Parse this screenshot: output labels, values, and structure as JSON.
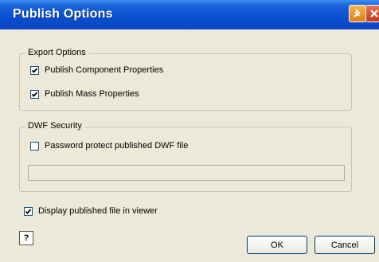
{
  "window": {
    "title": "Publish Options"
  },
  "export_options": {
    "label": "Export Options",
    "component_properties": {
      "label": "Publish Component Properties",
      "checked": true
    },
    "mass_properties": {
      "label": "Publish Mass Properties",
      "checked": true
    }
  },
  "dwf_security": {
    "label": "DWF Security",
    "password_protect": {
      "label": "Password protect published DWF file",
      "checked": false
    },
    "password_value": ""
  },
  "display_in_viewer": {
    "label": "Display published file in viewer",
    "checked": true
  },
  "buttons": {
    "help": "?",
    "ok": "OK",
    "cancel": "Cancel"
  },
  "colors": {
    "titlebar": "#0a4fd0",
    "dialog_bg": "#ece9d8"
  }
}
